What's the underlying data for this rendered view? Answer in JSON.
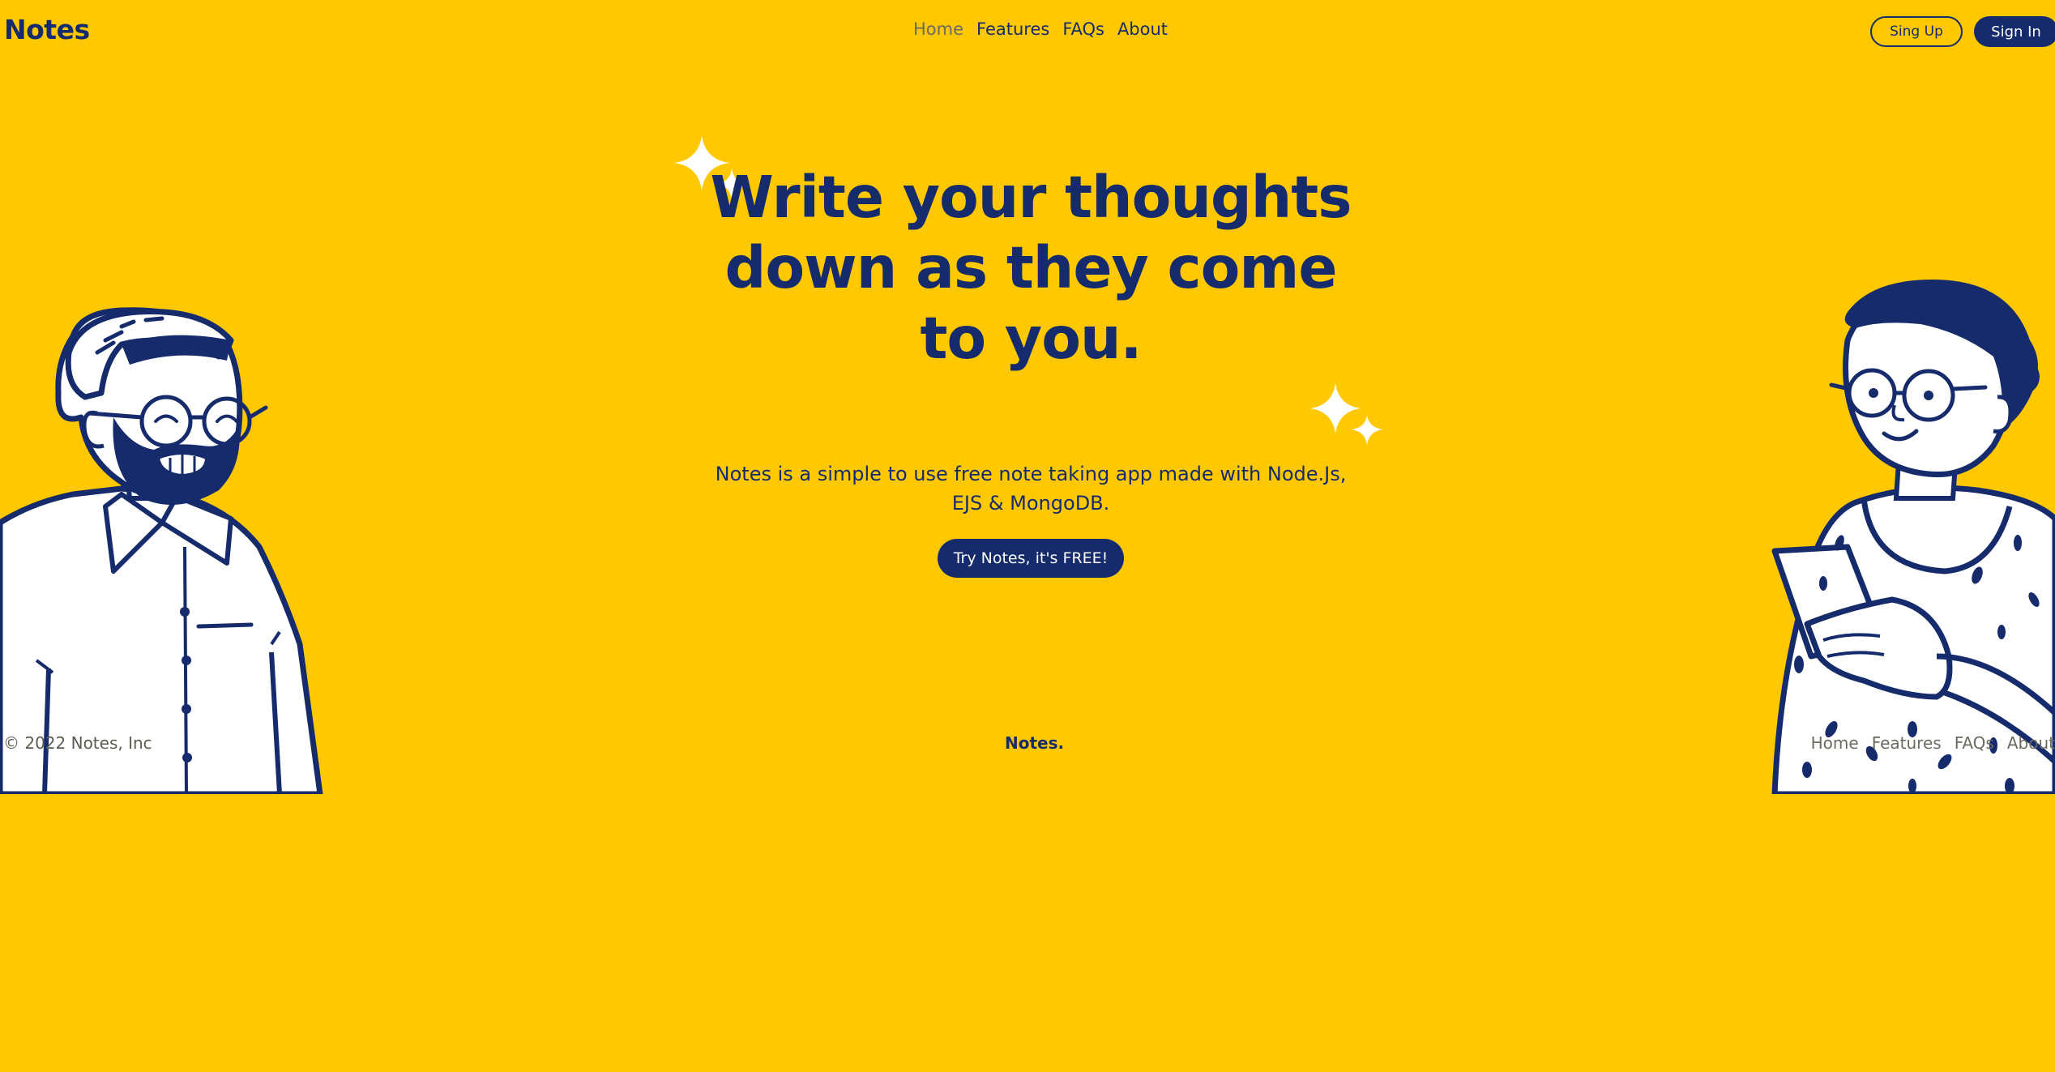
{
  "brand": {
    "logo": "Notes",
    "primary_color": "#152B6B",
    "background_color": "#FFC800"
  },
  "nav": {
    "items": [
      {
        "label": "Home",
        "active": true
      },
      {
        "label": "Features"
      },
      {
        "label": "FAQs"
      },
      {
        "label": "About"
      }
    ]
  },
  "auth": {
    "signup_label": "Sing Up",
    "signin_label": "Sign In"
  },
  "hero": {
    "title": "Write your thoughts down as they come to you.",
    "subtitle": "Notes is a simple to use free note taking app made with Node.Js, EJS & MongoDB.",
    "cta_label": "Try Notes, it's FREE!"
  },
  "footer": {
    "copyright": "© 2022 Notes, Inc",
    "brand": "Notes.",
    "links": [
      {
        "label": "Home"
      },
      {
        "label": "Features"
      },
      {
        "label": "FAQs"
      },
      {
        "label": "About"
      }
    ]
  },
  "icons": [
    "sparkle-icon",
    "man-illustration",
    "woman-illustration"
  ]
}
